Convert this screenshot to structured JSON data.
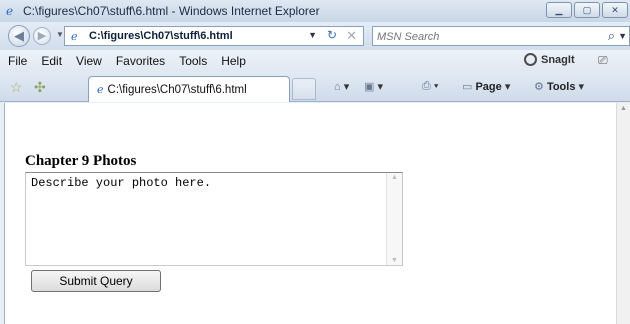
{
  "window": {
    "title": "C:\\figures\\Ch07\\stuff\\6.html - Windows Internet Explorer",
    "buttons": [
      "minimize",
      "maximize",
      "close"
    ]
  },
  "address_bar": {
    "url": "C:\\figures\\Ch07\\stuff\\6.html",
    "search_placeholder": "MSN Search"
  },
  "menu": {
    "items": [
      "File",
      "Edit",
      "View",
      "Favorites",
      "Tools",
      "Help"
    ],
    "snagit_label": "SnagIt"
  },
  "tab": {
    "label": "C:\\figures\\Ch07\\stuff\\6.html"
  },
  "commands": {
    "page_label": "Page",
    "tools_label": "Tools"
  },
  "content": {
    "heading": "Chapter 9 Photos",
    "textarea_value": "Describe your photo here.",
    "submit_label": "Submit Query"
  },
  "colors": {
    "chrome_bg": "#e8eef5",
    "accent": "#2b6cc4"
  },
  "icons": [
    "ie-icon",
    "back-icon",
    "forward-icon",
    "refresh-icon",
    "stop-icon",
    "search-icon",
    "favorites-star-icon",
    "add-favorites-icon",
    "home-icon",
    "feeds-icon",
    "print-icon",
    "page-icon",
    "tools-icon",
    "snagit-icon"
  ]
}
